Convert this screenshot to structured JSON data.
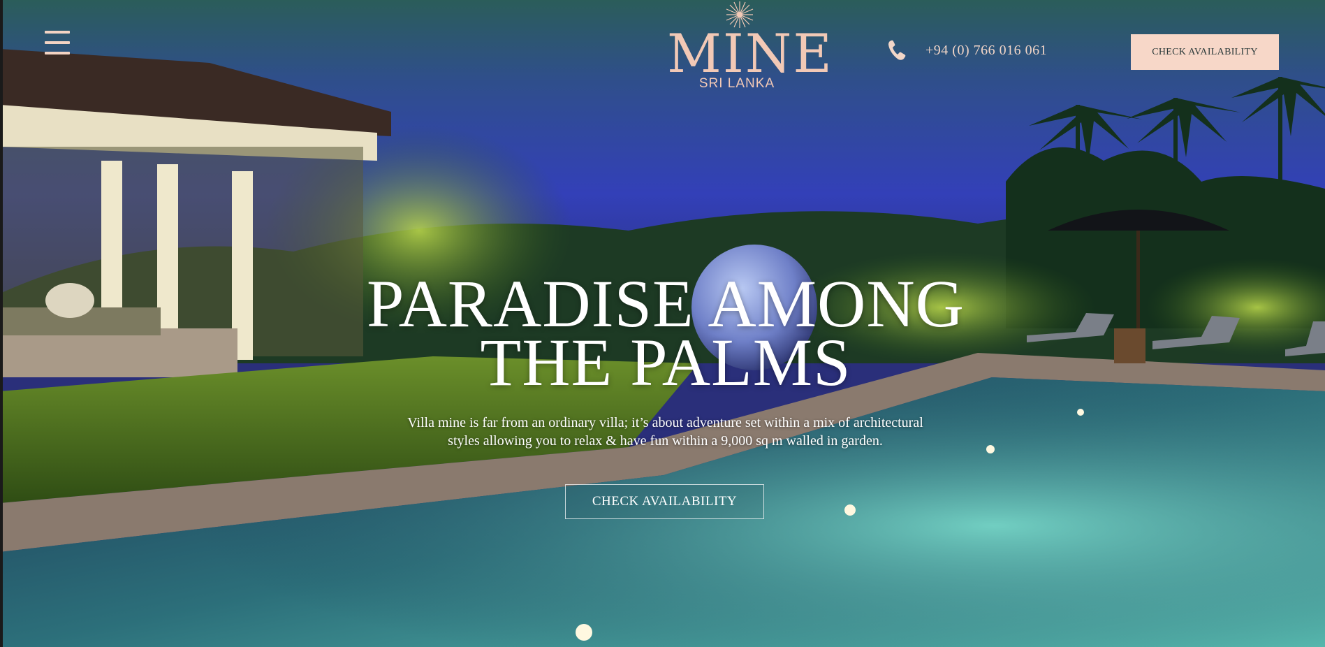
{
  "header": {
    "menu_icon": "hamburger-icon",
    "logo": {
      "word": "MINE",
      "subtitle": "SRI LANKA",
      "icon": "sunburst-icon"
    },
    "phone": {
      "icon": "phone-icon",
      "number": "+94 (0) 766 016 061"
    },
    "cta_label": "CHECK AVAILABILITY"
  },
  "hero": {
    "title_line1": "PARADISE AMONG",
    "title_line2": "THE PALMS",
    "description_line1": "Villa mine is far from an ordinary villa; it’s about adventure set within a mix of architectural",
    "description_line2": "styles allowing you to relax & have fun within a 9,000 sq m walled in garden.",
    "cta_label": "CHECK AVAILABILITY"
  },
  "colors": {
    "accent_pink": "#f7d7c8",
    "logo_pink": "#f2c9b6",
    "night_sky": "#2f3fb0",
    "pool": "#3fa9a3",
    "lawn": "#4d7a1f"
  }
}
